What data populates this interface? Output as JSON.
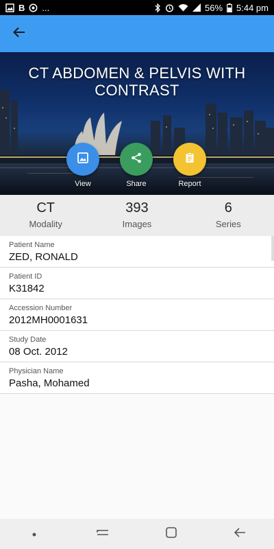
{
  "status_bar": {
    "left_extra": "...",
    "battery": "56%",
    "time": "5:44 pm",
    "icons": [
      "image-icon",
      "b-icon",
      "whatsapp-icon",
      "bluetooth-icon",
      "alarm-icon",
      "wifi-icon",
      "signal-icon",
      "battery-icon"
    ]
  },
  "app_bar": {
    "color": "#3d9cf2",
    "back_icon": "arrow-back-icon"
  },
  "hero": {
    "title": "CT ABDOMEN & PELVIS WITH CONTRAST",
    "actions": [
      {
        "label": "View",
        "icon": "image-icon",
        "color": "#3b8fe8"
      },
      {
        "label": "Share",
        "icon": "share-icon",
        "color": "#3a9d5e"
      },
      {
        "label": "Report",
        "icon": "clipboard-icon",
        "color": "#f4c331"
      }
    ]
  },
  "stats": [
    {
      "value": "CT",
      "caption": "Modality"
    },
    {
      "value": "393",
      "caption": "Images"
    },
    {
      "value": "6",
      "caption": "Series"
    }
  ],
  "details": [
    {
      "label": "Patient Name",
      "value": "ZED, RONALD"
    },
    {
      "label": "Patient ID",
      "value": "K31842"
    },
    {
      "label": "Accession Number",
      "value": "2012MH0001631"
    },
    {
      "label": "Study Date",
      "value": "08 Oct. 2012"
    },
    {
      "label": "Physician Name",
      "value": "Pasha, Mohamed"
    }
  ],
  "nav_bar": {
    "icons": [
      "dot-icon",
      "recent-apps-icon",
      "home-icon",
      "back-icon"
    ]
  }
}
